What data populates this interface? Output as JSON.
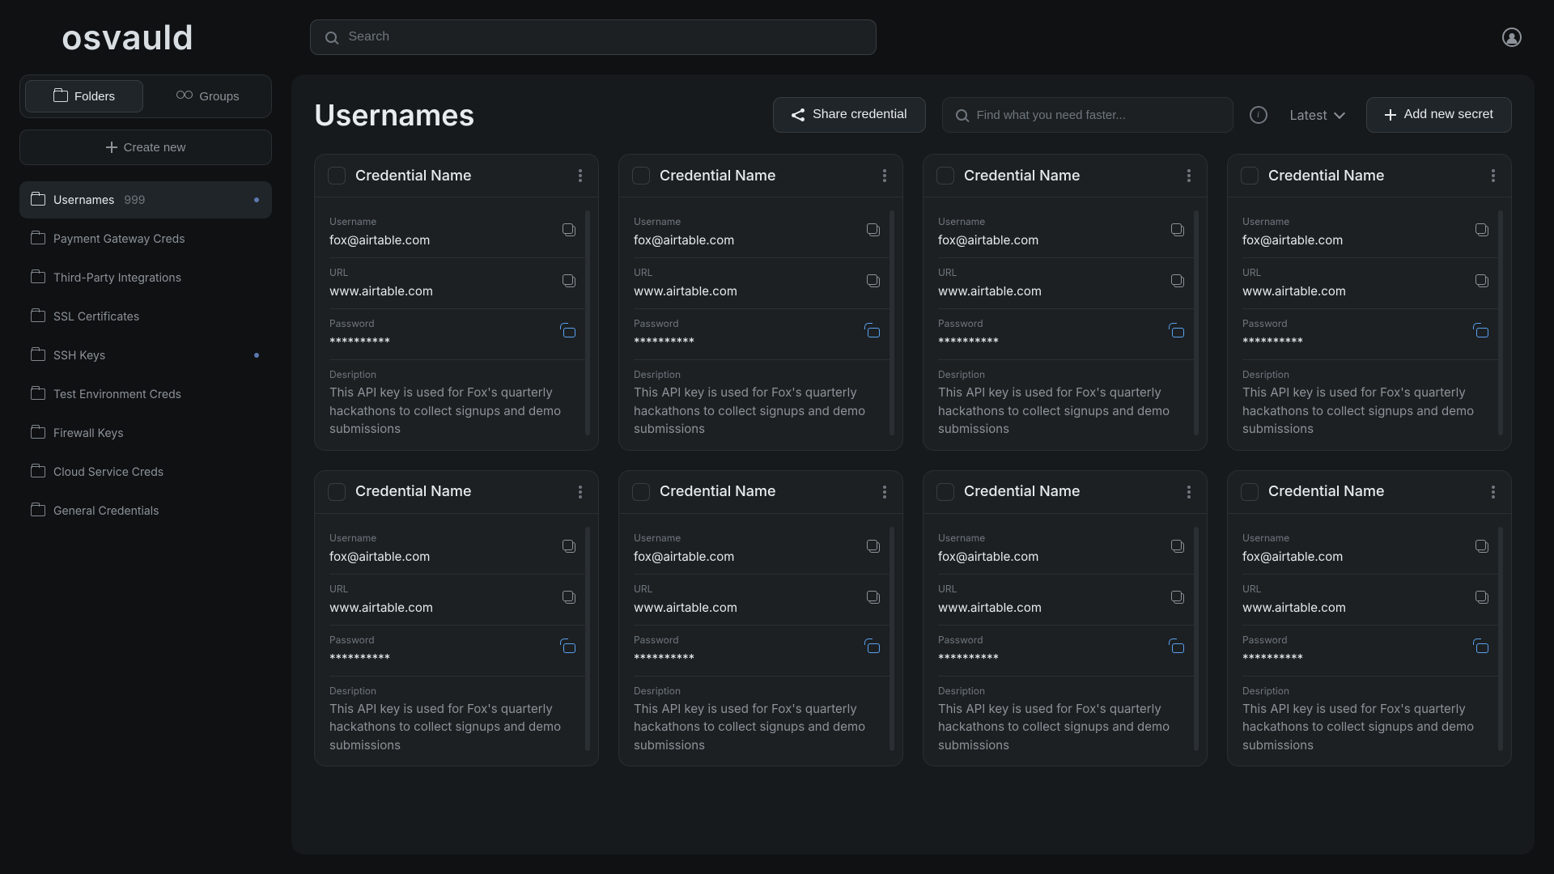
{
  "brand": "osvauld",
  "topbar": {
    "search_placeholder": "Search"
  },
  "sidebar": {
    "tabs": {
      "folders": "Folders",
      "groups": "Groups"
    },
    "create_label": "Create new",
    "folders": [
      {
        "label": "Usernames",
        "count": "999",
        "has_dot": true,
        "active": true
      },
      {
        "label": "Payment Gateway Creds",
        "has_dot": false,
        "active": false
      },
      {
        "label": "Third-Party Integrations",
        "has_dot": false,
        "active": false
      },
      {
        "label": "SSL Certificates",
        "has_dot": false,
        "active": false
      },
      {
        "label": "SSH Keys",
        "has_dot": true,
        "active": false
      },
      {
        "label": "Test Environment Creds",
        "has_dot": false,
        "active": false
      },
      {
        "label": "Firewall Keys",
        "has_dot": false,
        "active": false
      },
      {
        "label": "Cloud Service Creds",
        "has_dot": false,
        "active": false
      },
      {
        "label": "General Credentials",
        "has_dot": false,
        "active": false
      }
    ]
  },
  "main": {
    "title": "Usernames",
    "share_label": "Share credential",
    "search_placeholder": "Find what you need faster...",
    "sort_label": "Latest",
    "add_label": "Add new secret"
  },
  "card_labels": {
    "username": "Username",
    "url": "URL",
    "password": "Password",
    "description": "Desription"
  },
  "card_template": {
    "title": "Credential Name",
    "username": "fox@airtable.com",
    "url": "www.airtable.com",
    "password": "**********",
    "description": "This API key is used for Fox's quarterly hackathons to collect signups and demo submissions"
  },
  "cards": [
    {
      "title": "Credential Name",
      "username": "fox@airtable.com",
      "url": "www.airtable.com",
      "password": "**********",
      "description": "This API key is used for Fox's quarterly hackathons to collect signups and demo submissions"
    },
    {
      "title": "Credential Name",
      "username": "fox@airtable.com",
      "url": "www.airtable.com",
      "password": "**********",
      "description": "This API key is used for Fox's quarterly hackathons to collect signups and demo submissions"
    },
    {
      "title": "Credential Name",
      "username": "fox@airtable.com",
      "url": "www.airtable.com",
      "password": "**********",
      "description": "This API key is used for Fox's quarterly hackathons to collect signups and demo submissions"
    },
    {
      "title": "Credential Name",
      "username": "fox@airtable.com",
      "url": "www.airtable.com",
      "password": "**********",
      "description": "This API key is used for Fox's quarterly hackathons to collect signups and demo submissions"
    },
    {
      "title": "Credential Name",
      "username": "fox@airtable.com",
      "url": "www.airtable.com",
      "password": "**********",
      "description": "This API key is used for Fox's quarterly hackathons to collect signups and demo submissions"
    },
    {
      "title": "Credential Name",
      "username": "fox@airtable.com",
      "url": "www.airtable.com",
      "password": "**********",
      "description": "This API key is used for Fox's quarterly hackathons to collect signups and demo submissions"
    },
    {
      "title": "Credential Name",
      "username": "fox@airtable.com",
      "url": "www.airtable.com",
      "password": "**********",
      "description": "This API key is used for Fox's quarterly hackathons to collect signups and demo submissions"
    },
    {
      "title": "Credential Name",
      "username": "fox@airtable.com",
      "url": "www.airtable.com",
      "password": "**********",
      "description": "This API key is used for Fox's quarterly hackathons to collect signups and demo submissions"
    }
  ]
}
